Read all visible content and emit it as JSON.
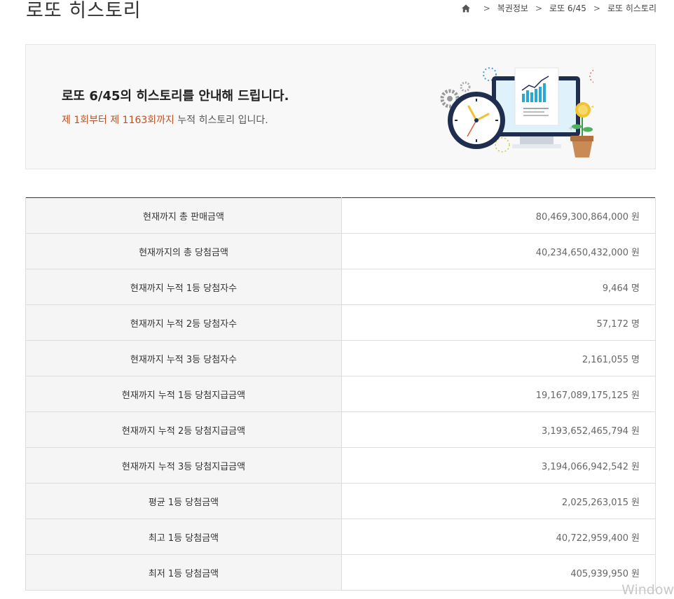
{
  "page": {
    "title": "로또 히스토리"
  },
  "breadcrumb": {
    "home_icon": "home-icon",
    "items": [
      "복권정보",
      "로또 6/45",
      "로또 히스토리"
    ]
  },
  "intro": {
    "heading": "로또 6/45의 히스토리를 안내해 드립니다.",
    "sub_highlight": "제 1회부터 제 1163회까지",
    "sub_rest": " 누적 히스토리 입니다.",
    "illustration": "clock-monitor-chart-illustration",
    "accent_color": "#c3501e"
  },
  "history_table": {
    "rows": [
      {
        "label": "현재까지 총 판매금액",
        "value": "80,469,300,864,000",
        "unit": "원"
      },
      {
        "label": "현재까지의 총 당첨금액",
        "value": "40,234,650,432,000",
        "unit": "원"
      },
      {
        "label": "현재까지 누적 1등 당첨자수",
        "value": "9,464",
        "unit": "명"
      },
      {
        "label": "현재까지 누적 2등 당첨자수",
        "value": "57,172",
        "unit": "명"
      },
      {
        "label": "현재까지 누적 3등 당첨자수",
        "value": "2,161,055",
        "unit": "명"
      },
      {
        "label": "현재까지 누적 1등 당첨지급금액",
        "value": "19,167,089,175,125",
        "unit": "원"
      },
      {
        "label": "현재까지 누적 2등 당첨지급금액",
        "value": "3,193,652,465,794",
        "unit": "원"
      },
      {
        "label": "현재까지 누적 3등 당첨지급금액",
        "value": "3,194,066,942,542",
        "unit": "원"
      },
      {
        "label": "평균 1등 당첨금액",
        "value": "2,025,263,015",
        "unit": "원"
      },
      {
        "label": "최고 1등 당첨금액",
        "value": "40,722,959,400",
        "unit": "원"
      },
      {
        "label": "최저 1등 당첨금액",
        "value": "405,939,950",
        "unit": "원"
      }
    ]
  },
  "watermark": {
    "text": "Window"
  }
}
